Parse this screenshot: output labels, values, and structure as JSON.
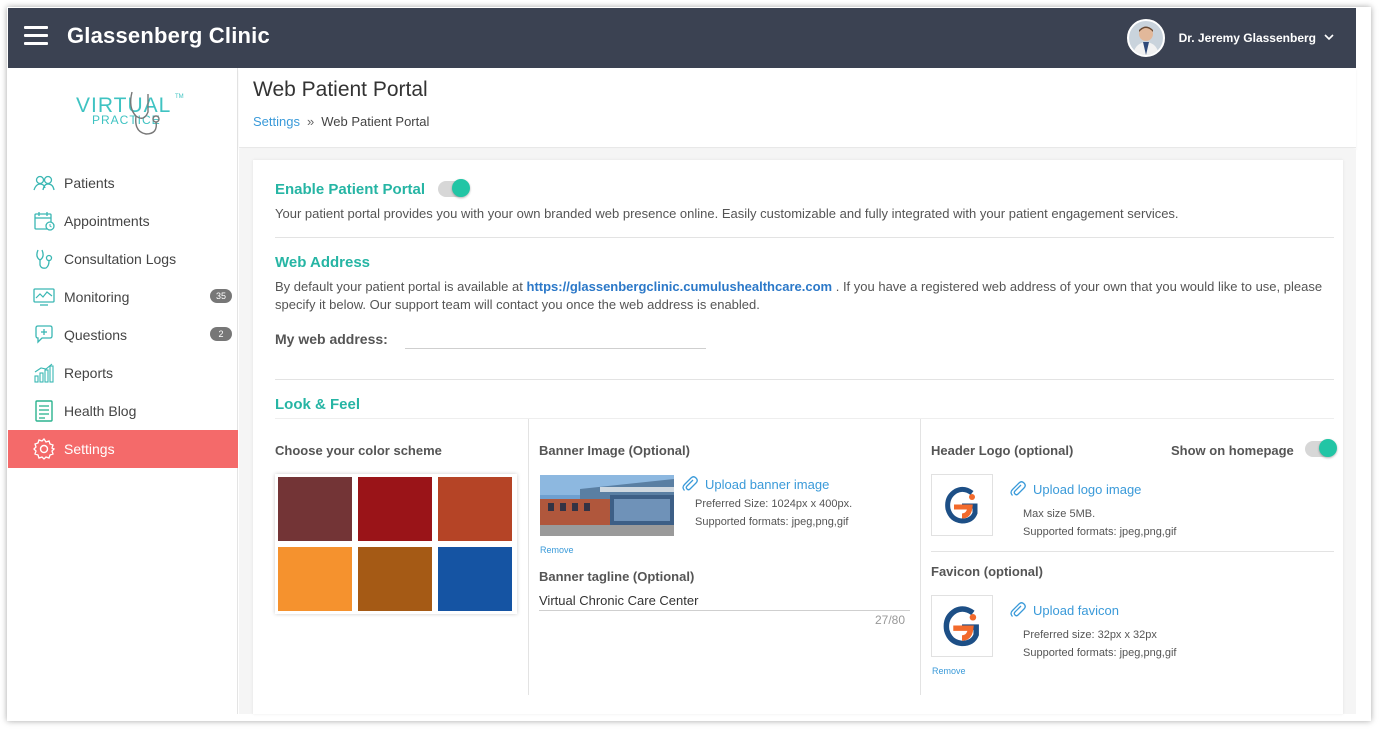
{
  "app": {
    "title": "Glassenberg Clinic"
  },
  "user": {
    "name": "Dr. Jeremy Glassenberg"
  },
  "logo": {
    "line1": "VIRTUAL",
    "line2": "PRACTICE",
    "tm": "TM"
  },
  "sidebar": {
    "items": [
      {
        "label": "Patients",
        "icon": "patients-icon"
      },
      {
        "label": "Appointments",
        "icon": "calendar-icon"
      },
      {
        "label": "Consultation Logs",
        "icon": "stethoscope-icon"
      },
      {
        "label": "Monitoring",
        "icon": "monitor-icon",
        "badge": "35"
      },
      {
        "label": "Questions",
        "icon": "chat-plus-icon",
        "badge": "2"
      },
      {
        "label": "Reports",
        "icon": "bar-chart-icon"
      },
      {
        "label": "Health Blog",
        "icon": "notebook-icon"
      },
      {
        "label": "Settings",
        "icon": "gear-icon",
        "active": true
      }
    ]
  },
  "page": {
    "title": "Web Patient Portal",
    "breadcrumb": {
      "parent": "Settings",
      "separator": "»",
      "current": "Web Patient Portal"
    }
  },
  "portal": {
    "enable_title": "Enable Patient Portal",
    "enabled": true,
    "enable_desc": "Your patient portal provides you with your own branded web presence online. Easily customizable and fully integrated with your patient engagement services.",
    "web_address_title": "Web Address",
    "web_desc_before": "By default your patient portal is available at",
    "web_url": "https://glassenbergclinic.cumulushealthcare.com",
    "web_desc_after": ". If you have a registered web address of your own that you would like to use, please specify it below. Our support team will contact you once the web address is enabled.",
    "my_web_address_label": "My web address:",
    "my_web_address_value": ""
  },
  "look_feel": {
    "title": "Look & Feel",
    "color_scheme_label": "Choose your color scheme",
    "colors": [
      "#733436",
      "#9a1418",
      "#b54426",
      "#f5922e",
      "#a55a15",
      "#1554a3"
    ],
    "banner": {
      "label": "Banner Image (Optional)",
      "upload": "Upload banner image",
      "pref_size": "Preferred Size: 1024px x 400px.",
      "formats": "Supported formats: jpeg,png,gif",
      "remove": "Remove",
      "tagline_label": "Banner tagline (Optional)",
      "tagline_value": "Virtual Chronic Care Center",
      "counter": "27/80"
    },
    "header_logo": {
      "label": "Header Logo (optional)",
      "show_label": "Show on homepage",
      "show_enabled": true,
      "upload": "Upload logo image",
      "max_size": "Max size 5MB.",
      "formats": "Supported formats: jpeg,png,gif"
    },
    "favicon": {
      "label": "Favicon (optional)",
      "upload": "Upload favicon",
      "pref_size": "Preferred size: 32px x 32px",
      "formats": "Supported formats: jpeg,png,gif",
      "remove": "Remove"
    }
  }
}
